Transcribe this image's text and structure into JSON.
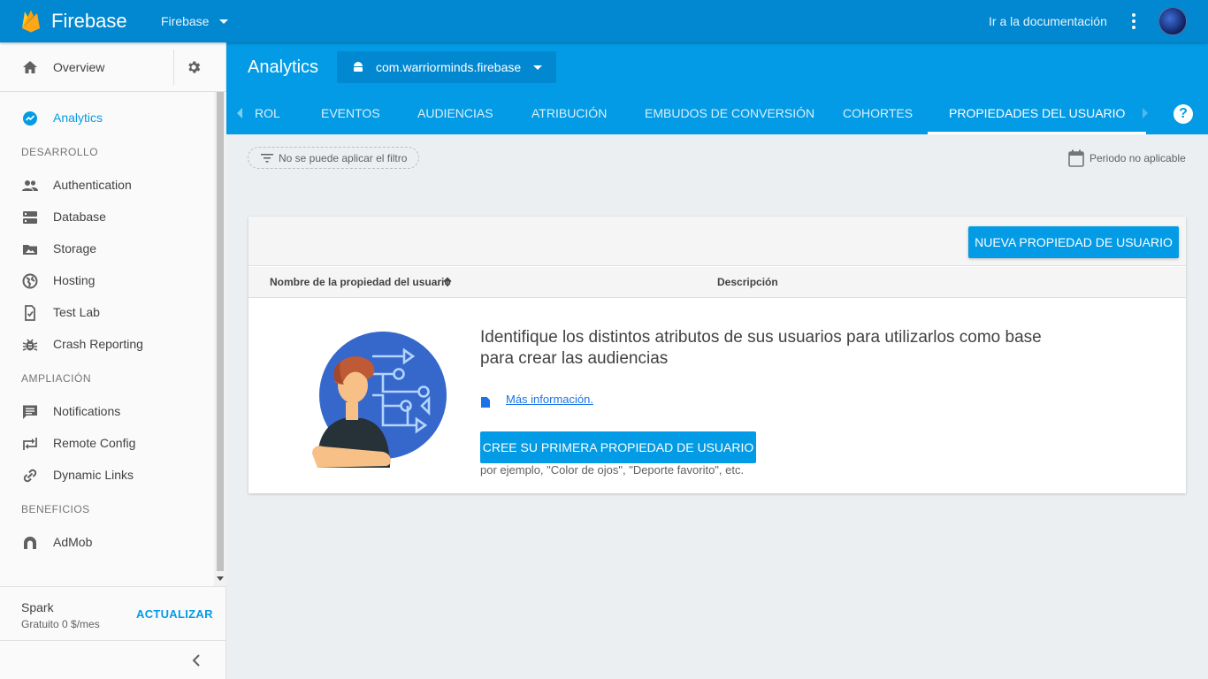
{
  "topbar": {
    "brand": "Firebase",
    "project_switch": "Firebase",
    "docs_link": "Ir a la documentación"
  },
  "sidebar": {
    "overview": "Overview",
    "analytics": "Analytics",
    "sections": {
      "develop": "DESARROLLO",
      "grow": "AMPLIACIÓN",
      "earn": "BENEFICIOS"
    },
    "develop_items": [
      "Authentication",
      "Database",
      "Storage",
      "Hosting",
      "Test Lab",
      "Crash Reporting"
    ],
    "grow_items": [
      "Notifications",
      "Remote Config",
      "Dynamic Links"
    ],
    "earn_items": [
      "AdMob"
    ],
    "plan": {
      "name": "Spark",
      "price": "Gratuito 0 $/mes",
      "upgrade": "ACTUALIZAR"
    }
  },
  "header": {
    "title": "Analytics",
    "app_selector": "com.warriorminds.firebase",
    "tabs": [
      "ROL",
      "EVENTOS",
      "AUDIENCIAS",
      "ATRIBUCIÓN",
      "EMBUDOS DE CONVERSIÓN",
      "COHORTES",
      "PROPIEDADES DEL USUARIO"
    ],
    "active_tab": "PROPIEDADES DEL USUARIO",
    "help_glyph": "?"
  },
  "filter": {
    "chip": "No se puede aplicar el filtro",
    "period": "Periodo no aplicable"
  },
  "card": {
    "new_button": "NUEVA PROPIEDAD DE USUARIO",
    "columns": {
      "name": "Nombre de la propiedad del usuario",
      "description": "Descripción"
    },
    "empty_title": "Identifique los distintos atributos de sus usuarios para utilizarlos como base para crear las audiencias",
    "more_link": "Más información.",
    "create_button": "CREE SU PRIMERA PROPIEDAD DE USUARIO",
    "hint": "por ejemplo, \"Color de ojos\", \"Deporte favorito\", etc."
  },
  "colors": {
    "topbar": "#0288d1",
    "band": "#039be5",
    "accent": "#039be5",
    "link": "#1a73e8",
    "background": "#eceff1"
  }
}
